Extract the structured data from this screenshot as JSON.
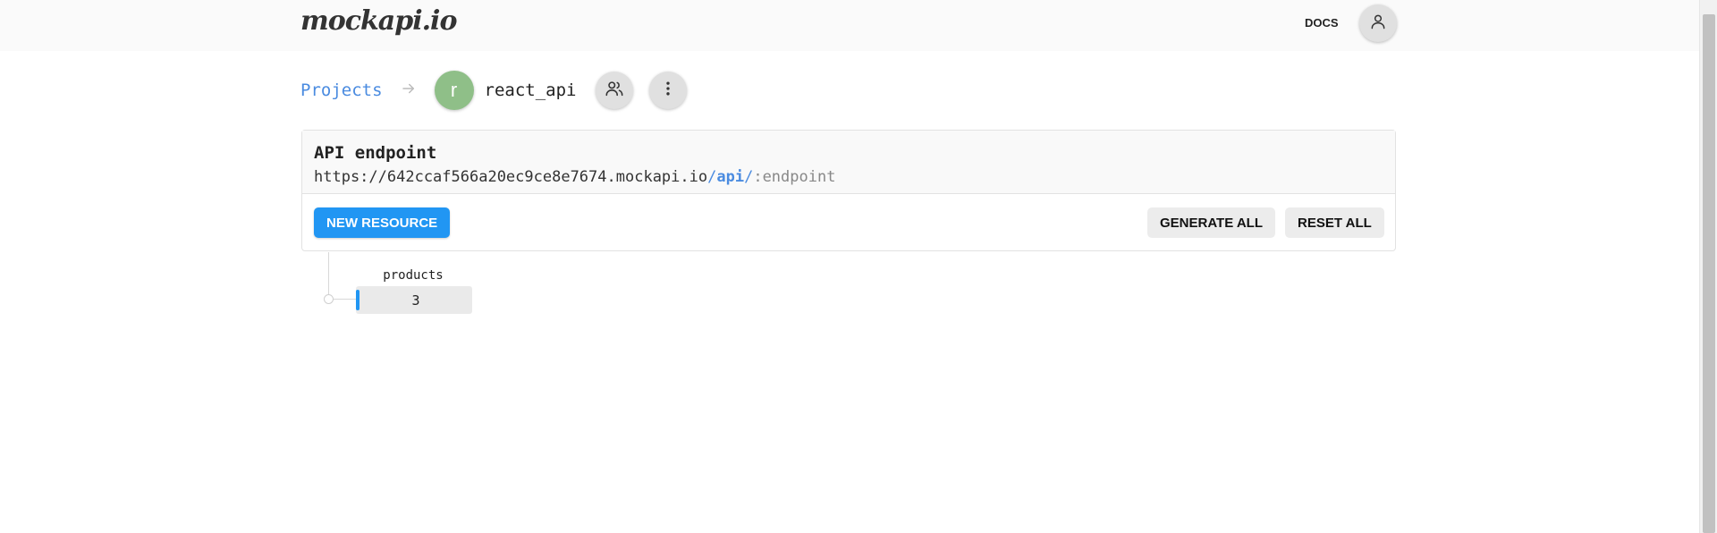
{
  "header": {
    "logo": "mockapi.io",
    "docs_label": "DOCS",
    "user_icon": "user-icon"
  },
  "breadcrumb": {
    "projects_label": "Projects",
    "separator_icon": "arrow-right-icon",
    "project_initial": "r",
    "project_name": "react_api",
    "collaborators_icon": "users-icon",
    "more_icon": "more-vertical-icon"
  },
  "endpoint": {
    "title": "API endpoint",
    "url_base": "https://642ccaf566a20ec9ce8e7674.mockapi.io",
    "url_slash1": "/",
    "url_api": "api",
    "url_slash2": "/",
    "url_placeholder": ":endpoint"
  },
  "actions": {
    "new_resource": "NEW RESOURCE",
    "generate_all": "GENERATE ALL",
    "reset_all": "RESET ALL"
  },
  "resources": [
    {
      "name": "products",
      "count": "3"
    }
  ],
  "colors": {
    "accent": "#2196f3",
    "link": "#4a8be0",
    "avatar": "#8fbf88"
  }
}
